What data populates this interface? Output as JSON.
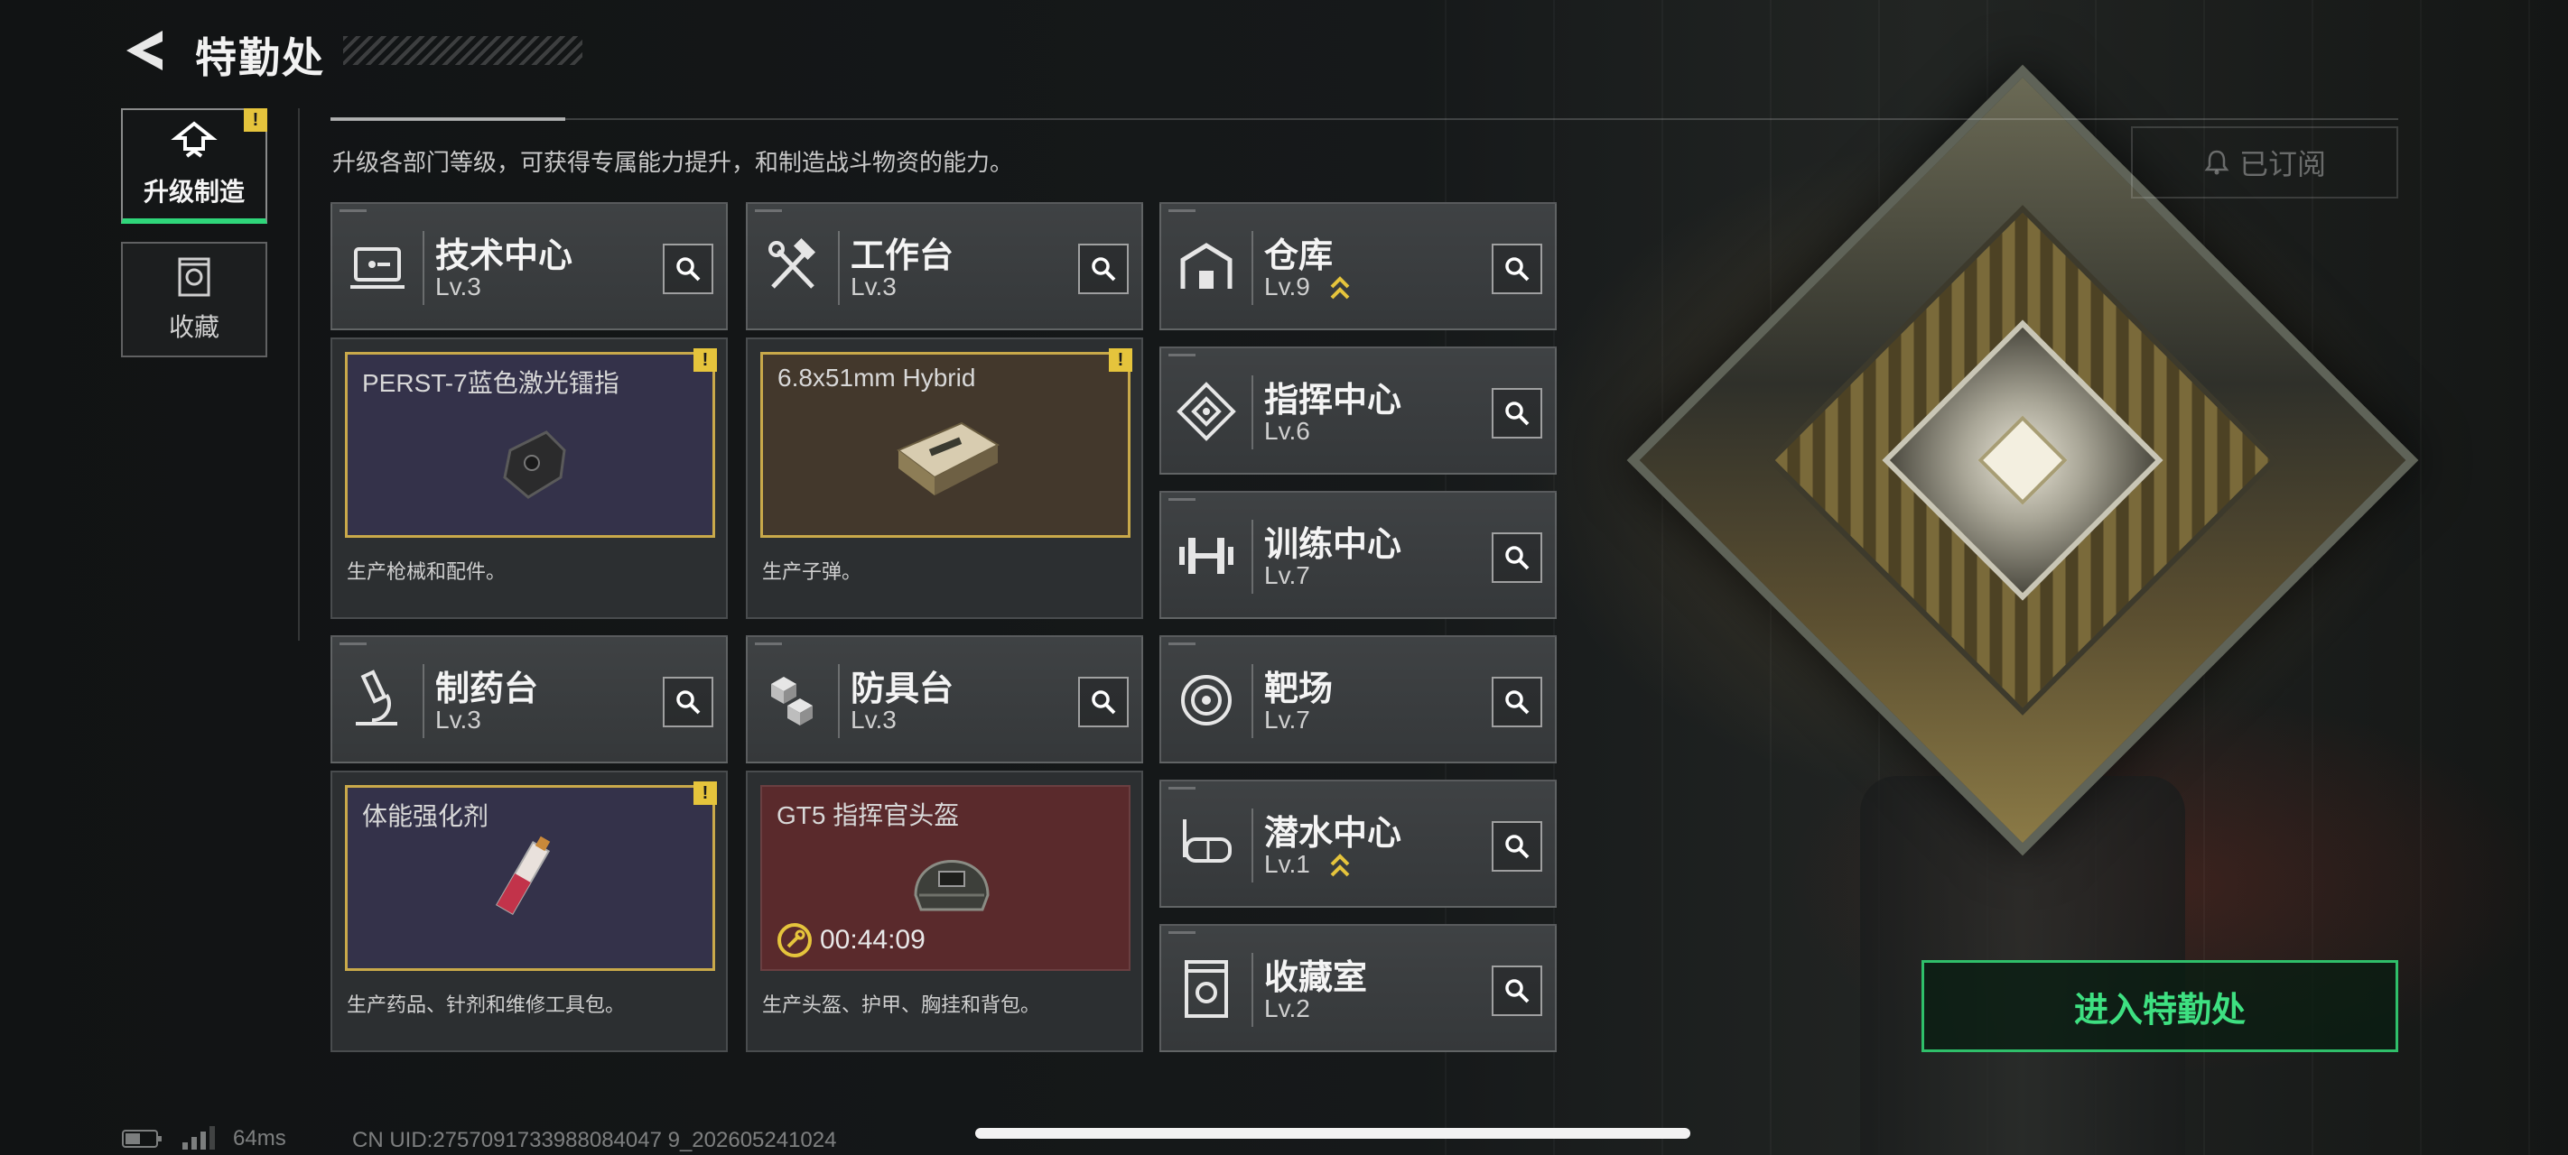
{
  "header": {
    "title": "特勤处",
    "description": "升级各部门等级，可获得专属能力提升，和制造战斗物资的能力。",
    "subscribed_label": "已订阅"
  },
  "tabs": [
    {
      "label": "升级制造",
      "active": true,
      "alert": "!"
    },
    {
      "label": "收藏",
      "active": false
    }
  ],
  "departments": [
    {
      "name": "技术中心",
      "level": "Lv.3",
      "icon": "tech-center-icon"
    },
    {
      "name": "工作台",
      "level": "Lv.3",
      "icon": "hammer-wrench-icon"
    },
    {
      "name": "仓库",
      "level": "Lv.9",
      "icon": "warehouse-icon",
      "upgradeable": true
    },
    {
      "name": "指挥中心",
      "level": "Lv.6",
      "icon": "command-center-icon"
    },
    {
      "name": "训练中心",
      "level": "Lv.7",
      "icon": "dumbbell-icon"
    },
    {
      "name": "制药台",
      "level": "Lv.3",
      "icon": "microscope-icon"
    },
    {
      "name": "防具台",
      "level": "Lv.3",
      "icon": "armor-blocks-icon"
    },
    {
      "name": "靶场",
      "level": "Lv.7",
      "icon": "target-icon"
    },
    {
      "name": "潜水中心",
      "level": "Lv.1",
      "icon": "diving-mask-icon",
      "upgradeable": true
    },
    {
      "name": "收藏室",
      "level": "Lv.2",
      "icon": "collection-room-icon"
    }
  ],
  "production": [
    {
      "item": "PERST-7蓝色激光镭指",
      "desc": "生产枪械和配件。",
      "alert": "!",
      "slot_color": "#34324a"
    },
    {
      "item": "6.8x51mm Hybrid",
      "desc": "生产子弹。",
      "alert": "!",
      "slot_color": "#43382c"
    },
    {
      "item": "体能强化剂",
      "desc": "生产药品、针剂和维修工具包。",
      "alert": "!",
      "slot_color": "#34324a"
    },
    {
      "item": "GT5 指挥官头盔",
      "desc": "生产头盔、护甲、胸挂和背包。",
      "timer": "00:44:09",
      "slot_color": "#5a2a2c"
    }
  ],
  "enter_button": "进入特勤处",
  "status": {
    "ping": "64ms",
    "uid": "CN UID:2757091733988084047 9_202605241024"
  },
  "colors": {
    "accent_green": "#3ee081",
    "alert_yellow": "#e5c43c",
    "upgrade_arrow": "#e5c43c"
  }
}
